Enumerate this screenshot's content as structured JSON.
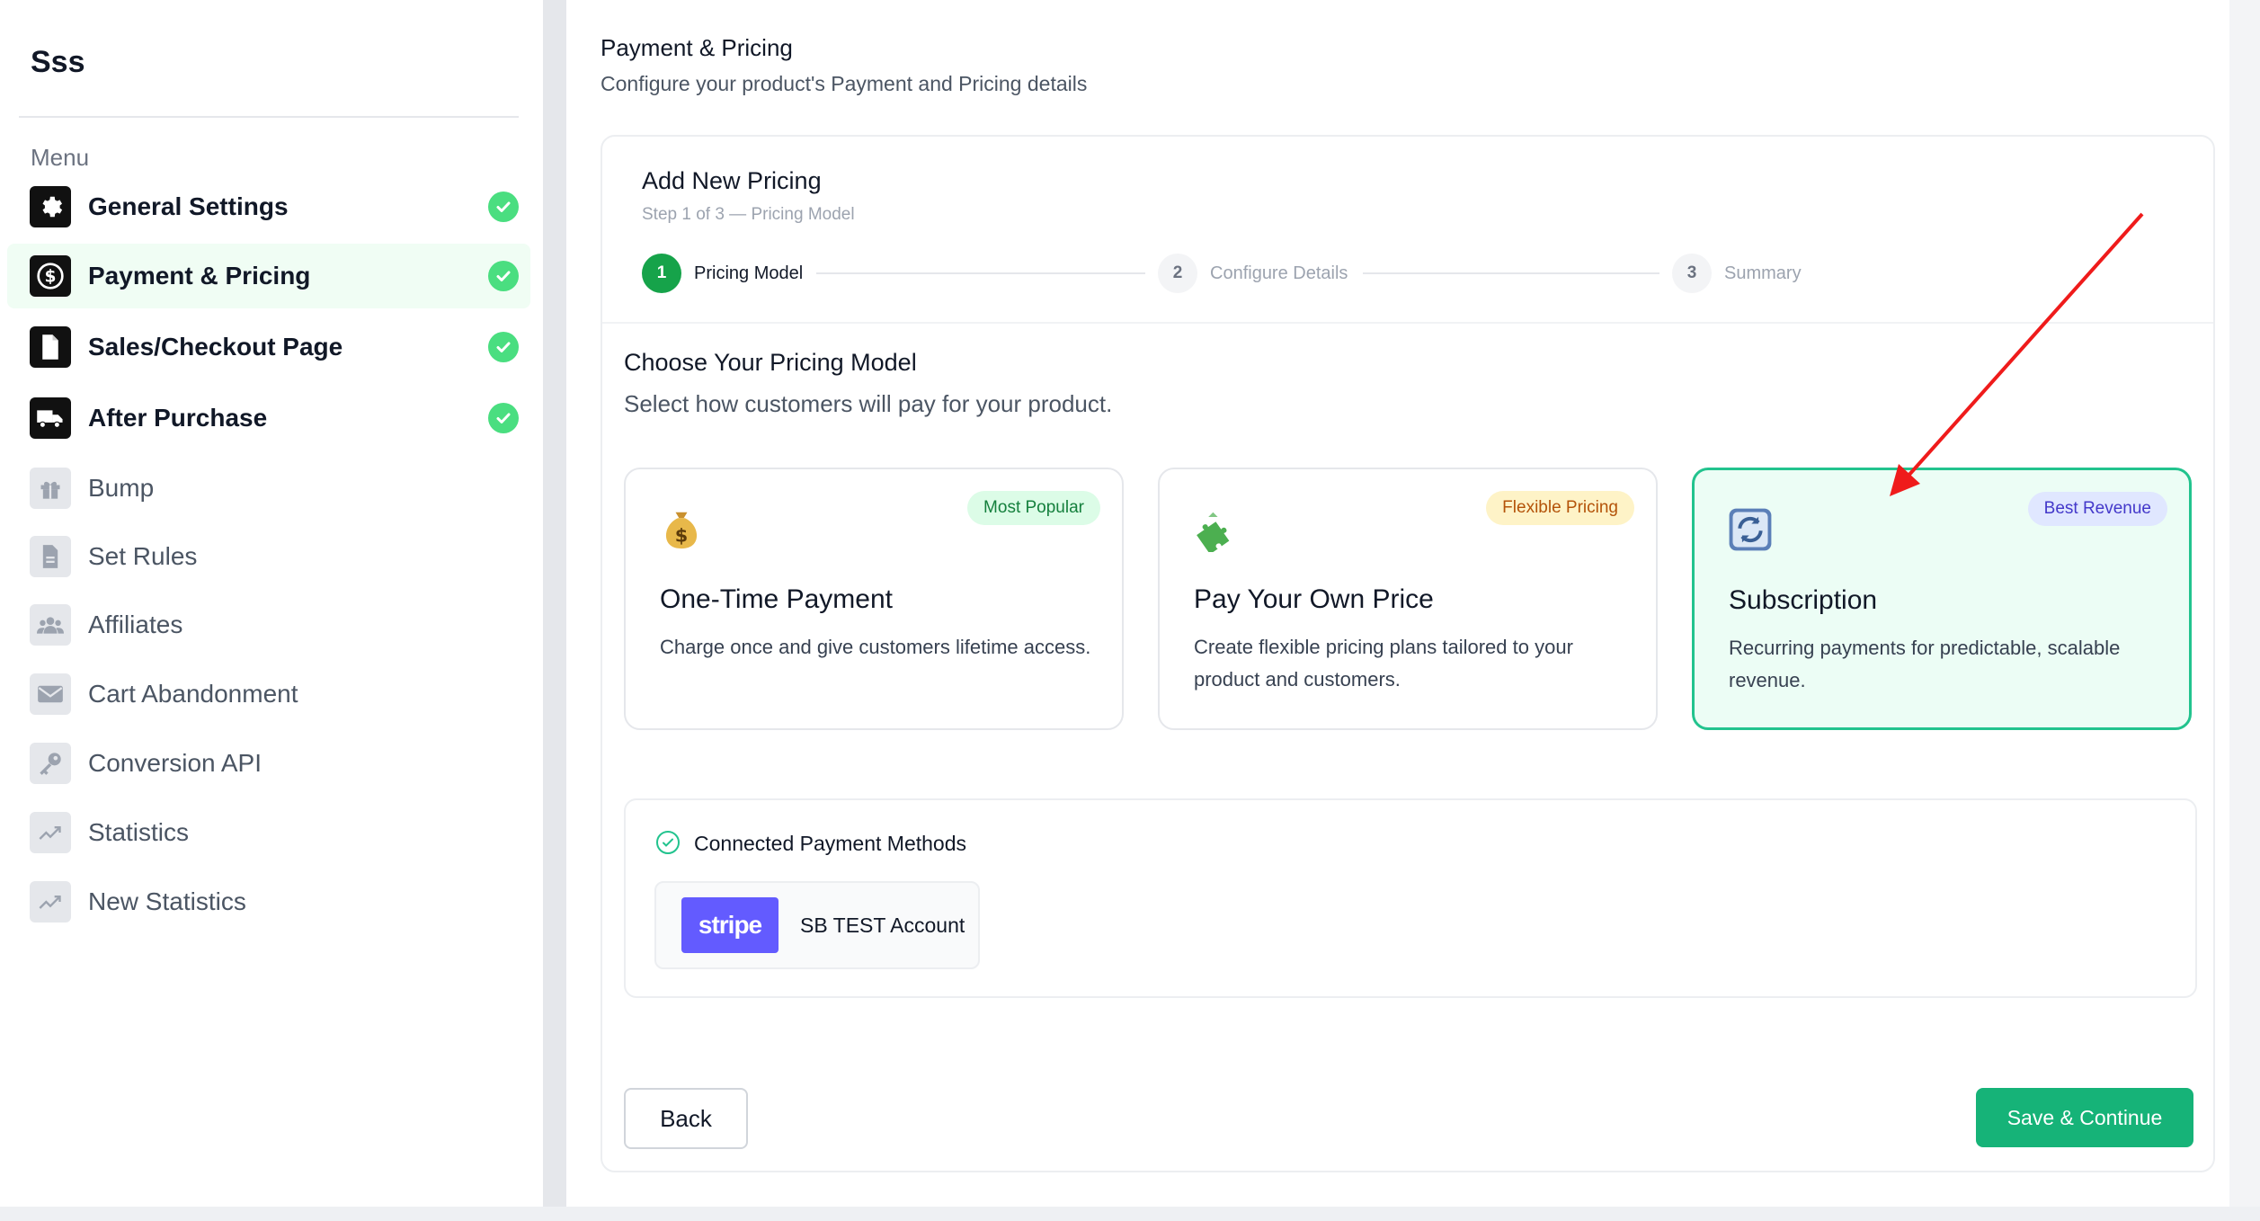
{
  "sidebar": {
    "brand": "Sss",
    "menu_heading": "Menu",
    "items": [
      {
        "label": "General Settings",
        "icon": "gear-icon",
        "completed": true
      },
      {
        "label": "Payment & Pricing",
        "icon": "dollar-icon",
        "completed": true,
        "active": true
      },
      {
        "label": "Sales/Checkout Page",
        "icon": "document-icon",
        "completed": true
      },
      {
        "label": "After Purchase",
        "icon": "truck-icon",
        "completed": true
      },
      {
        "label": "Bump",
        "icon": "gift-icon",
        "completed": false
      },
      {
        "label": "Set Rules",
        "icon": "file-icon",
        "completed": false
      },
      {
        "label": "Affiliates",
        "icon": "users-icon",
        "completed": false
      },
      {
        "label": "Cart Abandonment",
        "icon": "mail-icon",
        "completed": false
      },
      {
        "label": "Conversion API",
        "icon": "key-icon",
        "completed": false
      },
      {
        "label": "Statistics",
        "icon": "trend-icon",
        "completed": false
      },
      {
        "label": "New Statistics",
        "icon": "trend-icon",
        "completed": false
      }
    ]
  },
  "header": {
    "title": "Payment & Pricing",
    "subtitle": "Configure your product's Payment and Pricing details"
  },
  "panel": {
    "title": "Add New Pricing",
    "step_text": "Step 1 of 3 — Pricing Model",
    "steps": [
      {
        "number": "1",
        "label": "Pricing Model",
        "active": true
      },
      {
        "number": "2",
        "label": "Configure Details",
        "active": false
      },
      {
        "number": "3",
        "label": "Summary",
        "active": false
      }
    ],
    "section_title": "Choose Your Pricing Model",
    "section_subtitle": "Select how customers will pay for your product."
  },
  "pricing_cards": [
    {
      "title": "One-Time Payment",
      "description": "Charge once and give customers lifetime access.",
      "badge": "Most Popular",
      "icon": "money-bag-icon",
      "selected": false,
      "badge_color": "#dcfce7",
      "badge_text_color": "#15803d"
    },
    {
      "title": "Pay Your Own Price",
      "description": "Create flexible pricing plans tailored to your product and customers.",
      "badge": "Flexible Pricing",
      "icon": "puzzle-icon",
      "selected": false,
      "badge_color": "#fef3c7",
      "badge_text_color": "#b45309"
    },
    {
      "title": "Subscription",
      "description": "Recurring payments for predictable, scalable revenue.",
      "badge": "Best Revenue",
      "icon": "refresh-icon",
      "selected": true,
      "badge_color": "#e0e7ff",
      "badge_text_color": "#4338ca"
    }
  ],
  "payment_methods": {
    "title": "Connected Payment Methods",
    "account": {
      "logo_text": "stripe",
      "name": "SB TEST Account"
    }
  },
  "actions": {
    "back_label": "Back",
    "save_label": "Save & Continue"
  },
  "colors": {
    "accent": "#16b378",
    "selected_card_border": "#22c38e",
    "annotation_arrow": "#ef1b1b"
  }
}
